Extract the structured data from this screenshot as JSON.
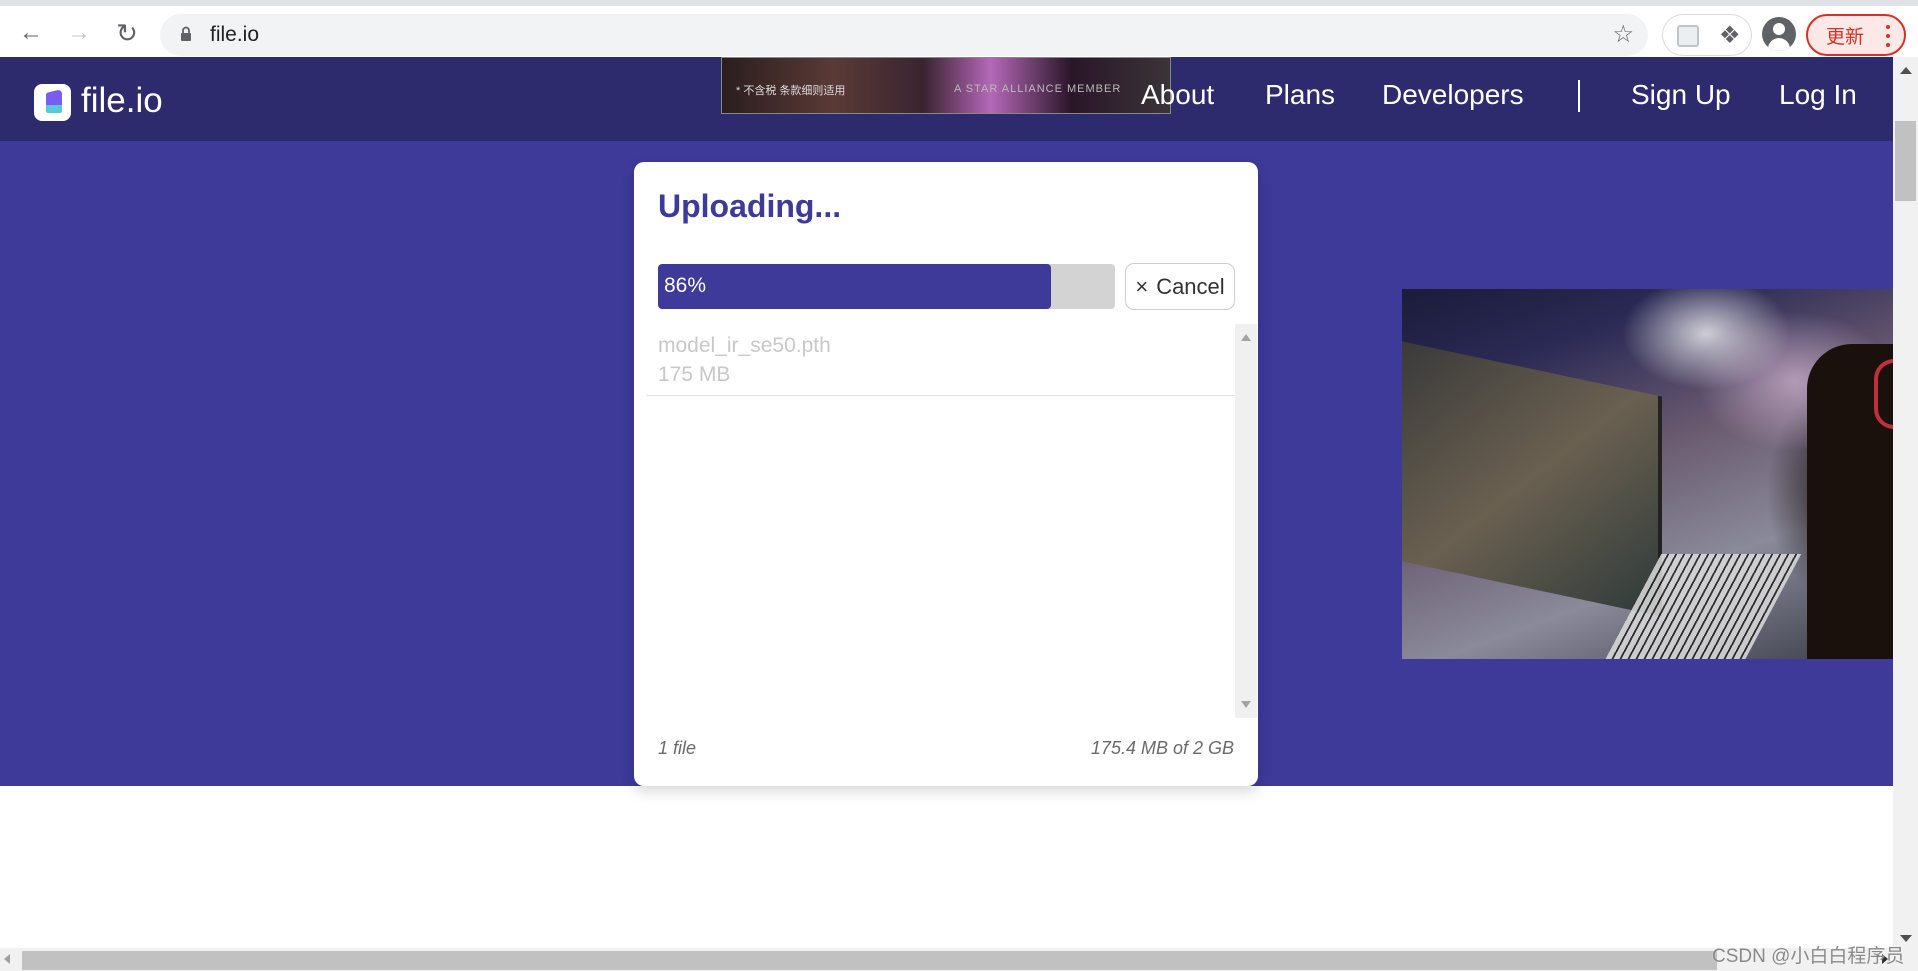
{
  "browser": {
    "url": "file.io",
    "update_label": "更新",
    "icons": {
      "back": "arrow-left-icon",
      "forward": "arrow-right-icon",
      "reload": "reload-icon",
      "lock": "lock-icon",
      "bookmark": "star-icon",
      "extension": "puzzle-icon",
      "profile": "user-icon",
      "menu": "kebab-icon"
    }
  },
  "header": {
    "logo_text": "file.io",
    "ad": {
      "text_left": "* 不含税 条款细则适用",
      "text_right": "A STAR ALLIANCE MEMBER"
    },
    "nav": [
      {
        "label": "About"
      },
      {
        "label": "Plans"
      },
      {
        "label": "Developers"
      },
      {
        "label": "Sign Up"
      },
      {
        "label": "Log In"
      }
    ]
  },
  "upload": {
    "title": "Uploading...",
    "progress_percent": 86,
    "progress_label": "86%",
    "cancel_icon": "×",
    "cancel_label": "Cancel",
    "files": [
      {
        "name": "model_ir_se50.pth",
        "size": "175 MB"
      }
    ],
    "footer_count": "1 file",
    "footer_quota": "175.4 MB of 2 GB"
  },
  "colors": {
    "header_bg": "#2d2a6e",
    "brand": "#3d3a9a",
    "progress_track": "#d3d3d3",
    "update_red": "#d93025"
  },
  "watermark": "CSDN @小白白程序员"
}
